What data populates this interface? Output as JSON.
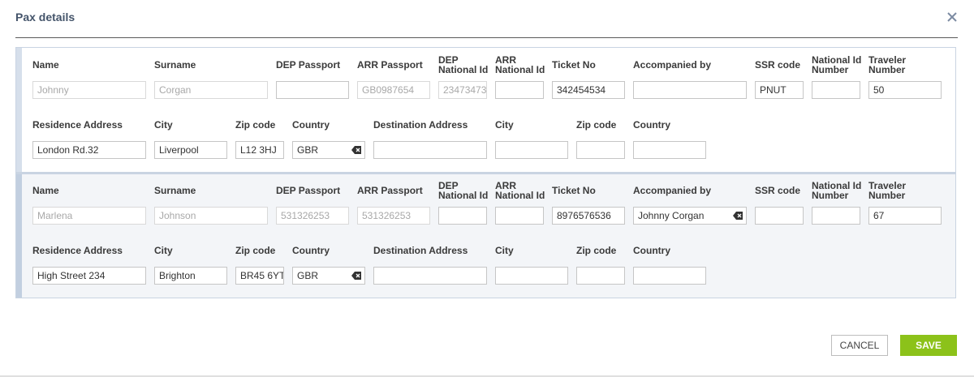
{
  "dialog": {
    "title": "Pax details",
    "close_icon": "close-icon"
  },
  "labels": {
    "name": "Name",
    "surname": "Surname",
    "dep_passport": "DEP Passport",
    "arr_passport": "ARR Passport",
    "dep_national_id_1": "DEP",
    "dep_national_id_2": "National Id",
    "arr_national_id_1": "ARR",
    "arr_national_id_2": "National Id",
    "ticket_no": "Ticket No",
    "accompanied_by": "Accompanied by",
    "ssr_code": "SSR code",
    "national_id_number_1": "National Id",
    "national_id_number_2": "Number",
    "traveler_number_1": "Traveler",
    "traveler_number_2": "Number",
    "residence_address": "Residence Address",
    "city": "City",
    "zip_code": "Zip code",
    "country": "Country",
    "destination_address": "Destination Address"
  },
  "passengers": [
    {
      "name": "Johnny",
      "surname": "Corgan",
      "dep_passport": "",
      "arr_passport": "GB0987654",
      "dep_national_id": "23473473",
      "arr_national_id": "",
      "ticket_no": "342454534",
      "accompanied_by": "",
      "ssr_code": "PNUT",
      "national_id_number": "",
      "traveler_number": "50",
      "residence_address": "London Rd.32",
      "residence_city": "Liverpool",
      "residence_zip": "L12 3HJ",
      "residence_country": "GBR",
      "destination_address": "",
      "destination_city": "",
      "destination_zip": "",
      "destination_country": ""
    },
    {
      "name": "Marlena",
      "surname": "Johnson",
      "dep_passport": "531326253",
      "arr_passport": "531326253",
      "dep_national_id": "",
      "arr_national_id": "",
      "ticket_no": "8976576536",
      "accompanied_by": "Johnny Corgan",
      "ssr_code": "",
      "national_id_number": "",
      "traveler_number": "67",
      "residence_address": "High Street 234",
      "residence_city": "Brighton",
      "residence_zip": "BR45 6YT",
      "residence_country": "GBR",
      "destination_address": "",
      "destination_city": "",
      "destination_zip": "",
      "destination_country": ""
    }
  ],
  "buttons": {
    "cancel": "CANCEL",
    "save": "SAVE"
  },
  "colors": {
    "accent_save": "#8cc21a",
    "title": "#44546a"
  }
}
